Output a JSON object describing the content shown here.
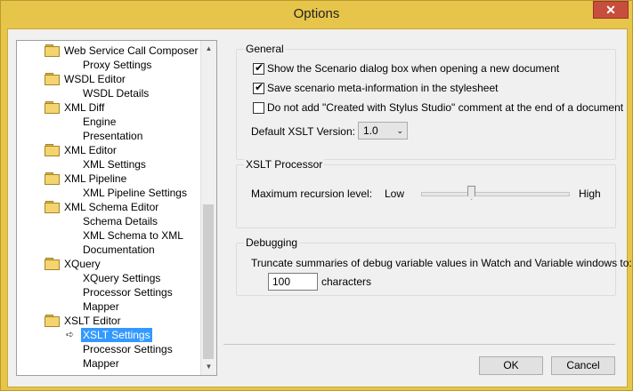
{
  "window": {
    "title": "Options",
    "close_glyph": "✕"
  },
  "tree": {
    "items": [
      {
        "label": "Web Service Call Composer",
        "folder": true
      },
      {
        "label": "Proxy Settings"
      },
      {
        "label": "WSDL Editor",
        "folder": true
      },
      {
        "label": "WSDL Details"
      },
      {
        "label": "XML Diff",
        "folder": true
      },
      {
        "label": "Engine"
      },
      {
        "label": "Presentation"
      },
      {
        "label": "XML Editor",
        "folder": true
      },
      {
        "label": "XML Settings"
      },
      {
        "label": "XML Pipeline",
        "folder": true
      },
      {
        "label": "XML Pipeline Settings"
      },
      {
        "label": "XML Schema Editor",
        "folder": true
      },
      {
        "label": "Schema Details"
      },
      {
        "label": "XML Schema to XML"
      },
      {
        "label": "Documentation"
      },
      {
        "label": "XQuery",
        "folder": true
      },
      {
        "label": "XQuery Settings"
      },
      {
        "label": "Processor Settings"
      },
      {
        "label": "Mapper"
      },
      {
        "label": "XSLT Editor",
        "folder": true
      },
      {
        "label": "XSLT Settings",
        "selected": true
      },
      {
        "label": "Processor Settings"
      },
      {
        "label": "Mapper"
      }
    ],
    "selected_indicator": "➪"
  },
  "general": {
    "title": "General",
    "show_scenario": {
      "label": "Show the Scenario dialog box when opening a new document",
      "checked": true
    },
    "save_meta": {
      "label": "Save scenario meta-information in the stylesheet",
      "checked": true
    },
    "no_comment": {
      "label": "Do not add \"Created with Stylus Studio\" comment at the end of a document",
      "checked": false
    },
    "xslt_version_label": "Default XSLT Version:",
    "xslt_version_value": "1.0"
  },
  "xslt_processor": {
    "title": "XSLT Processor",
    "recursion_label": "Maximum recursion level:",
    "low": "Low",
    "high": "High",
    "level_fraction": 0.34
  },
  "debugging": {
    "title": "Debugging",
    "truncate_label": "Truncate summaries of debug variable values in Watch and Variable windows to:",
    "characters_value": "100",
    "characters_unit": "characters"
  },
  "buttons": {
    "ok": "OK",
    "cancel": "Cancel"
  },
  "colors": {
    "frame": "#e6c54a",
    "selection": "#3399ff",
    "close": "#c74d3c"
  }
}
